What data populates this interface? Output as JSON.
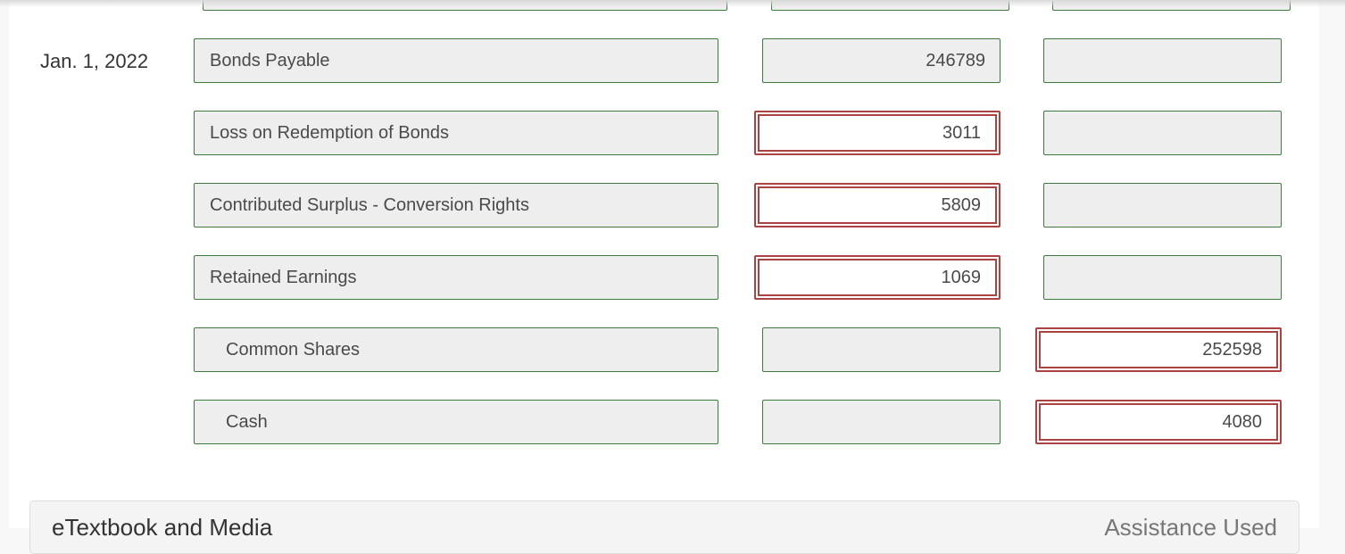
{
  "journal_entry": {
    "date": "Jan. 1, 2022",
    "rows": [
      {
        "account": "Bonds Payable",
        "debit": "246789",
        "credit": "",
        "debit_flag": "ok",
        "credit_flag": "ok"
      },
      {
        "account": "Loss on Redemption of Bonds",
        "debit": "3011",
        "credit": "",
        "debit_flag": "incorrect",
        "credit_flag": "ok"
      },
      {
        "account": "Contributed Surplus - Conversion Rights",
        "debit": "5809",
        "credit": "",
        "debit_flag": "incorrect",
        "credit_flag": "ok"
      },
      {
        "account": "Retained Earnings",
        "debit": "1069",
        "credit": "",
        "debit_flag": "incorrect",
        "credit_flag": "ok"
      },
      {
        "account": "Common Shares",
        "debit": "",
        "credit": "252598",
        "debit_flag": "ok",
        "credit_flag": "incorrect"
      },
      {
        "account": "Cash",
        "debit": "",
        "credit": "4080",
        "debit_flag": "ok",
        "credit_flag": "incorrect"
      }
    ]
  },
  "colors": {
    "correct_border": "#3f7a3f",
    "incorrect_border": "#a94442",
    "field_bg": "#eeeeee"
  },
  "footer": {
    "left_label": "eTextbook and Media",
    "right_label": "Assistance Used"
  }
}
